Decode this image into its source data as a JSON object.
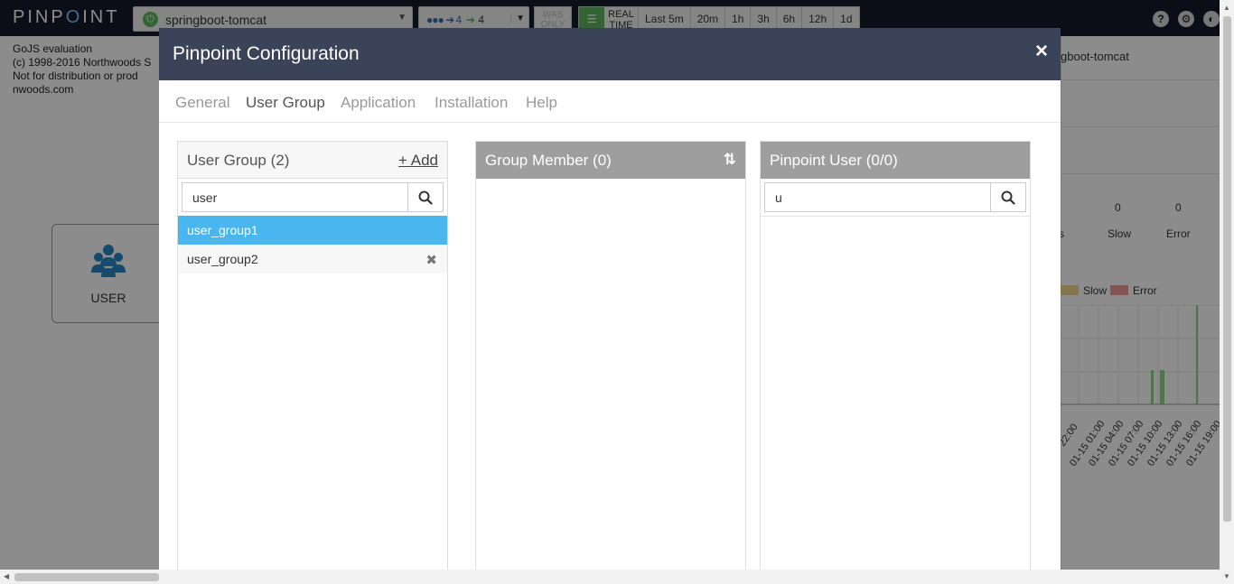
{
  "topbar": {
    "logo_prefix": "PINP",
    "logo_dot": "O",
    "logo_suffix": "INT",
    "app_name": "springboot-tomcat",
    "depth_in": "4",
    "depth_out": "4",
    "was_only": "WAS ONLY",
    "realtime": "REAL TIME",
    "ranges": [
      "Last 5m",
      "20m",
      "1h",
      "3h",
      "6h",
      "12h",
      "1d"
    ]
  },
  "background": {
    "gojs_lines": [
      "GoJS evaluation",
      "(c) 1998-2016 Northwoods S",
      "Not for distribution or prod",
      "nwoods.com"
    ],
    "user_node_label": "USER",
    "right_app": "gboot-tomcat",
    "counts": {
      "slow_value": "0",
      "error_value": "0",
      "slow_label": "Slow",
      "error_label": "Error",
      "cut_label": "s"
    },
    "legend": {
      "slow": "Slow",
      "error": "Error"
    },
    "axis_labels": [
      "22:00",
      "01-15 01:00",
      "01-15 04:00",
      "01-15 07:00",
      "01-15 10:00",
      "01-15 13:00",
      "01-15 16:00",
      "01-15 19:00"
    ]
  },
  "modal": {
    "title": "Pinpoint Configuration",
    "close": "×",
    "tabs": [
      "General",
      "User Group",
      "Application",
      "Installation",
      "Help"
    ],
    "active_tab": "User Group",
    "user_group": {
      "title": "User Group (2)",
      "add": "+ Add",
      "search_value": "user",
      "items": [
        "user_group1",
        "user_group2"
      ]
    },
    "group_member": {
      "title": "Group Member (0)"
    },
    "pinpoint_user": {
      "title": "Pinpoint User (0/0)",
      "search_value": "u"
    }
  },
  "colors": {
    "header_bg": "#3a4358",
    "selected_item": "#4ab6f0",
    "panel_dark": "#9e9e9e",
    "topbar": "#14192b"
  }
}
